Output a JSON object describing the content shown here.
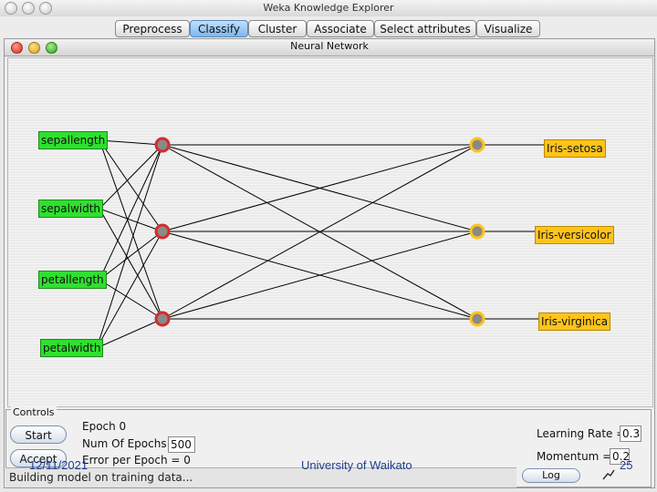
{
  "window": {
    "title": "Weka Knowledge Explorer"
  },
  "tabs": [
    {
      "label": "Preprocess",
      "active": false
    },
    {
      "label": "Classify",
      "active": true
    },
    {
      "label": "Cluster",
      "active": false
    },
    {
      "label": "Associate",
      "active": false
    },
    {
      "label": "Select attributes",
      "active": false
    },
    {
      "label": "Visualize",
      "active": false
    }
  ],
  "nn_window": {
    "title": "Neural Network"
  },
  "network": {
    "inputs": [
      "sepallength",
      "sepalwidth",
      "petallength",
      "petalwidth"
    ],
    "hidden_count": 3,
    "output_count": 3,
    "outputs": [
      "Iris-setosa",
      "Iris-versicolor",
      "Iris-virginica"
    ],
    "input_color": "#2fe02f",
    "hidden_color": "#d62b2b",
    "output_color": "#ffc41a"
  },
  "controls": {
    "title": "Controls",
    "start_label": "Start",
    "accept_label": "Accept",
    "epoch_text": "Epoch  0",
    "num_epochs_label": "Num Of Epochs",
    "num_epochs_value": "500",
    "error_text": "Error per Epoch = 0",
    "learning_rate_label": "Learning Rate  =",
    "learning_rate_value": "0.3",
    "momentum_label": "Momentum  =",
    "momentum_value": "0.2",
    "status_text": "Building model on training data...",
    "log_label": "Log"
  },
  "footer": {
    "date": "12/11/2021",
    "center": "University of Waikato",
    "page": "25"
  }
}
